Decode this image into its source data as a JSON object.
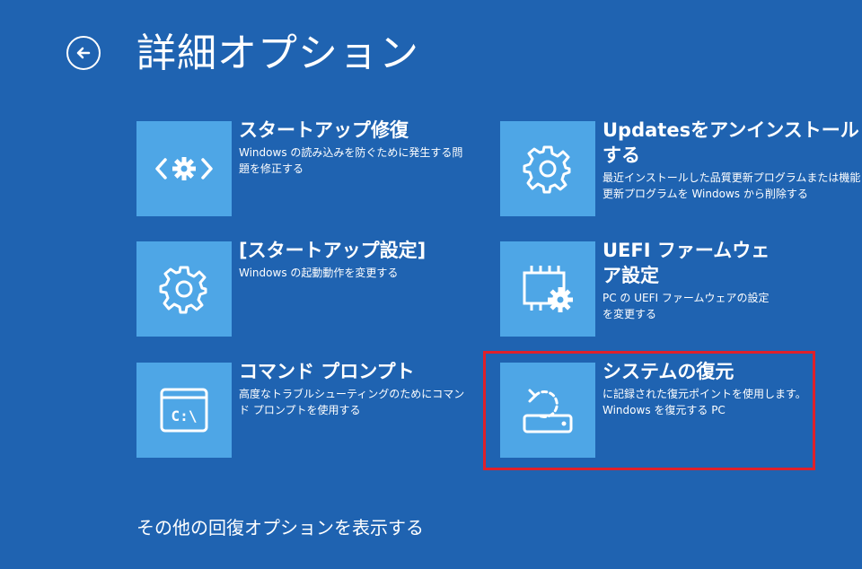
{
  "header": {
    "title": "詳細オプション"
  },
  "tiles": [
    {
      "title": "スタートアップ修復",
      "desc": "Windows の読み込みを防ぐために発生する問題を修正する",
      "icon": "startup-repair-icon"
    },
    {
      "title": "[スタートアップ設定]",
      "desc": "Windows の起動動作を変更する",
      "icon": "gear-icon"
    },
    {
      "title": "コマンド プロンプト",
      "desc": "高度なトラブルシューティングのためにコマンド プロンプトを使用する",
      "icon": "command-prompt-icon",
      "icon_text": "C:\\"
    },
    {
      "title": "Updatesをアンインストールする",
      "desc": "最近インストールした品質更新プログラムまたは機能更新プログラムを Windows から削除する",
      "icon": "gear-icon"
    },
    {
      "title": "UEFI ファームウェア設定",
      "desc": "PC の UEFI ファームウェアの設定を変更する",
      "icon": "uefi-firmware-icon"
    },
    {
      "title": "システムの復元",
      "desc_line1": "に記録された復元ポイントを使用します。",
      "desc_line2": "Windows を復元する PC",
      "icon": "system-restore-icon"
    }
  ],
  "more_link": "その他の回復オプションを表示する",
  "colors": {
    "background": "#1f63b1",
    "tile_icon_bg": "#4ea6e6",
    "highlight": "#e0202a",
    "text": "#ffffff"
  }
}
